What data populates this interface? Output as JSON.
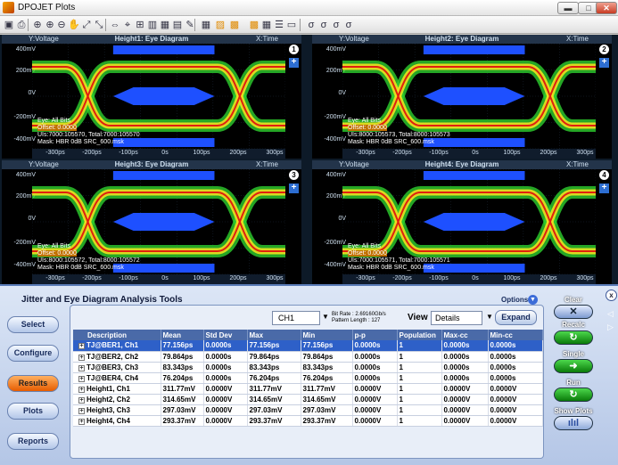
{
  "window": {
    "title": "DPOJET Plots",
    "min_glyph": "▬",
    "max_glyph": "□",
    "close_glyph": "✕"
  },
  "toolbar": {
    "icons": [
      "save-icon",
      "print-icon",
      "zoom-icon",
      "zoom-in-icon",
      "zoom-out-icon",
      "pan-icon",
      "zoom-fit-icon",
      "zoom-fit-h-icon",
      "cursor-icon",
      "cursor-mode-icon",
      "measure-icon",
      "histogram-icon",
      "histogram2-icon",
      "display-icon",
      "wrench-icon",
      "table-icon",
      "split-icon",
      "marker-icon",
      "layout-icon",
      "grid-icon",
      "list-icon",
      "window-icon",
      "fx1-icon",
      "fx2-icon",
      "fx3-icon",
      "fx4-icon"
    ]
  },
  "plots": [
    {
      "y_label": "Y:Voltage",
      "title": "Height1: Eye Diagram",
      "x_label": "X:Time",
      "num": "1",
      "plus": "+",
      "y_ticks": [
        "400mV",
        "200mV",
        "0V",
        "-200mV",
        "-400mV"
      ],
      "x_ticks": [
        "-300ps",
        "-200ps",
        "-100ps",
        "0s",
        "100ps",
        "200ps",
        "300ps"
      ],
      "info1": "Eye: All Bits",
      "info2": "Offset: 0.0000",
      "info3": "UIs:7000:105570, Total:7000:105570",
      "info4": "Mask: HBR 0dB SRC_600.msk"
    },
    {
      "y_label": "Y:Voltage",
      "title": "Height2: Eye Diagram",
      "x_label": "X:Time",
      "num": "2",
      "plus": "+",
      "y_ticks": [
        "400mV",
        "200mV",
        "0V",
        "-200mV",
        "-400mV"
      ],
      "x_ticks": [
        "-300ps",
        "-200ps",
        "-100ps",
        "0s",
        "100ps",
        "200ps",
        "300ps"
      ],
      "info1": "Eye: All Bits",
      "info2": "Offset: 0.0000",
      "info3": "UIs:8000:105573, Total:8000:105573",
      "info4": "Mask: HBR 0dB SRC_600.msk"
    },
    {
      "y_label": "Y:Voltage",
      "title": "Height3: Eye Diagram",
      "x_label": "X:Time",
      "num": "3",
      "plus": "+",
      "y_ticks": [
        "400mV",
        "200mV",
        "0V",
        "-200mV",
        "-400mV"
      ],
      "x_ticks": [
        "-300ps",
        "-200ps",
        "-100ps",
        "0s",
        "100ps",
        "200ps",
        "300ps"
      ],
      "info1": "Eye: All Bits",
      "info2": "Offset: 0.0000",
      "info3": "UIs:8000:105572, Total:8000:105572",
      "info4": "Mask: HBR 0dB SRC_600.msk"
    },
    {
      "y_label": "Y:Voltage",
      "title": "Height4: Eye Diagram",
      "x_label": "X:Time",
      "num": "4",
      "plus": "+",
      "y_ticks": [
        "400mV",
        "200mV",
        "0V",
        "-200mV",
        "-400mV"
      ],
      "x_ticks": [
        "-300ps",
        "-200ps",
        "-100ps",
        "0s",
        "100ps",
        "200ps",
        "300ps"
      ],
      "info1": "Eye: All Bits",
      "info2": "Offset: 0.0000",
      "info3": "UIs:7000:105571, Total:7000:105571",
      "info4": "Mask: HBR 0dB SRC_600.msk"
    }
  ],
  "panel": {
    "title": "Jitter and Eye Diagram Analysis Tools",
    "nav": [
      "Select",
      "Configure",
      "Results",
      "Plots",
      "Reports"
    ],
    "options": "Options",
    "channel": "CH1",
    "bit_rate": "Bit Rate : 2.69160Gb/s",
    "pattern_length": "Pattern Length : 127",
    "view_label": "View",
    "view_value": "Details",
    "expand": "Expand",
    "columns": [
      "Description",
      "Mean",
      "Std Dev",
      "Max",
      "Min",
      "p-p",
      "Population",
      "Max-cc",
      "Min-cc"
    ],
    "rows": [
      [
        "TJ@BER1, Ch1",
        "77.156ps",
        "0.0000s",
        "77.156ps",
        "77.156ps",
        "0.0000s",
        "1",
        "0.0000s",
        "0.0000s"
      ],
      [
        "TJ@BER2, Ch2",
        "79.864ps",
        "0.0000s",
        "79.864ps",
        "79.864ps",
        "0.0000s",
        "1",
        "0.0000s",
        "0.0000s"
      ],
      [
        "TJ@BER3, Ch3",
        "83.343ps",
        "0.0000s",
        "83.343ps",
        "83.343ps",
        "0.0000s",
        "1",
        "0.0000s",
        "0.0000s"
      ],
      [
        "TJ@BER4, Ch4",
        "76.204ps",
        "0.0000s",
        "76.204ps",
        "76.204ps",
        "0.0000s",
        "1",
        "0.0000s",
        "0.0000s"
      ],
      [
        "Height1, Ch1",
        "311.77mV",
        "0.0000V",
        "311.77mV",
        "311.77mV",
        "0.0000V",
        "1",
        "0.0000V",
        "0.0000V"
      ],
      [
        "Height2, Ch2",
        "314.65mV",
        "0.0000V",
        "314.65mV",
        "314.65mV",
        "0.0000V",
        "1",
        "0.0000V",
        "0.0000V"
      ],
      [
        "Height3, Ch3",
        "297.03mV",
        "0.0000V",
        "297.03mV",
        "297.03mV",
        "0.0000V",
        "1",
        "0.0000V",
        "0.0000V"
      ],
      [
        "Height4, Ch4",
        "293.37mV",
        "0.0000V",
        "293.37mV",
        "293.37mV",
        "0.0000V",
        "1",
        "0.0000V",
        "0.0000V"
      ]
    ]
  },
  "side": {
    "clear": "Clear",
    "recalc": "Recalc",
    "single": "Single",
    "run": "Run",
    "show_plots": "Show Plots",
    "close": "x",
    "clear_glyph": "✕",
    "recalc_glyph": "↻",
    "single_glyph": "➜",
    "run_glyph": "↻",
    "show_glyph": "ılıl"
  },
  "colors": {
    "plot_bg": "#000000",
    "eye_green": "#2ed02e",
    "eye_yellow": "#f0e020",
    "eye_red": "#e02010",
    "mask_blue": "#1e50ff",
    "select_row": "#2e60c8",
    "panel_bg": "#c4d4ee"
  }
}
